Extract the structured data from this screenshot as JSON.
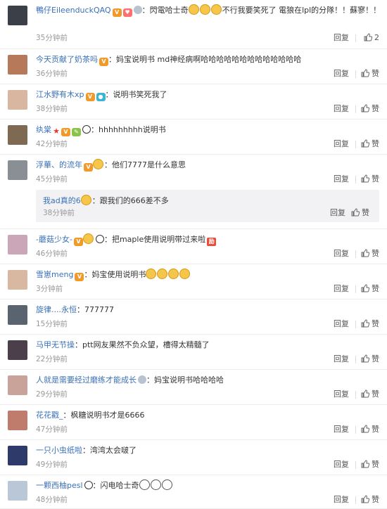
{
  "actions": {
    "reply": "回复",
    "like": "赞"
  },
  "comments": [
    {
      "user": "鴨仔EileenduckQAQ",
      "text": "閃電哈士奇",
      "text2": "不行我要笑死了 電狼在lpl的分隊！！蘇寥！！",
      "time": "35分钟前",
      "likes": "2",
      "badges": [
        "vip",
        "heart",
        "ring"
      ],
      "emojis": 3
    },
    {
      "user": "今天贡献了奶茶吗",
      "text": "妈宝说明书 md神经病啊哈哈哈哈哈哈哈哈哈哈哈哈哈",
      "time": "36分钟前",
      "likes": "赞",
      "badges": [
        "vip"
      ]
    },
    {
      "user": "江水野有木xp",
      "text": "说明书笑死我了",
      "time": "38分钟前",
      "likes": "赞",
      "badges": [
        "vip",
        "cam"
      ]
    },
    {
      "user": "纨棠",
      "text": "hhhhhhhhh说明书",
      "time": "42分钟前",
      "likes": "赞",
      "badges": [
        "star",
        "vip",
        "leaf",
        "panda"
      ]
    },
    {
      "user": "浮華、的流年",
      "text": "他们7777是什么意思",
      "time": "45分钟前",
      "likes": "赞",
      "badges": [
        "vip",
        "emo"
      ],
      "reply": {
        "user": "我ad真的6",
        "text": "跟我们的666差不多",
        "time": "38分钟前",
        "likes": "赞"
      }
    },
    {
      "user": "-蘑菇少女-",
      "text": "把maple使用说明带过来啦",
      "time": "46分钟前",
      "likes": "赞",
      "badges": [
        "vip",
        "emo",
        "panda"
      ],
      "tail_badge": "励"
    },
    {
      "user": "雪崽meng",
      "text": "妈宝使用说明书",
      "time": "3分钟前",
      "likes": "赞",
      "badges": [
        "vip"
      ],
      "emojis": 4
    },
    {
      "user": "旋律....永恒",
      "text": "777777",
      "time": "15分钟前",
      "likes": "赞",
      "badges": []
    },
    {
      "user": "马甲无节操",
      "text": "ptt网友果然不负众望，槽得太精髓了",
      "time": "22分钟前",
      "likes": "赞",
      "badges": []
    },
    {
      "user": "人就是需要经过磨练才能成长",
      "text": "妈宝说明书哈哈哈哈",
      "time": "29分钟前",
      "likes": "赞",
      "badges": [
        "ring"
      ]
    },
    {
      "user": "花花戳_",
      "text": "枫糖说明书才是6666",
      "time": "47分钟前",
      "likes": "赞",
      "badges": []
    },
    {
      "user": "一只小虫纸啦",
      "text": "湾湾太会啵了",
      "time": "49分钟前",
      "likes": "赞",
      "badges": []
    },
    {
      "user": "一颗西柚pesl",
      "text": "闪电哈士奇",
      "time": "48分钟前",
      "likes": "赞",
      "badges": [
        "panda"
      ],
      "emojis_grey": 3
    }
  ]
}
